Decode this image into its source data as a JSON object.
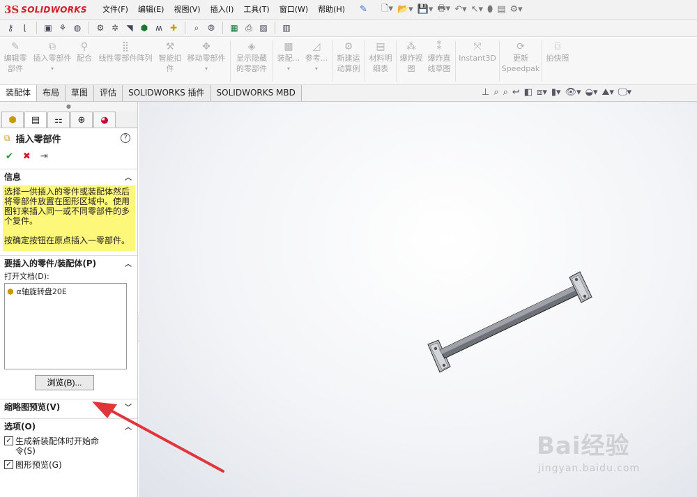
{
  "app": {
    "logo_ds": "3S",
    "logo_name": "SOLIDWORKS"
  },
  "menu": [
    "文件(F)",
    "编辑(E)",
    "视图(V)",
    "插入(I)",
    "工具(T)",
    "窗口(W)",
    "帮助(H)"
  ],
  "commands": [
    {
      "label": "编辑零\n部件",
      "icon": "edit-component-icon"
    },
    {
      "label": "插入零部件",
      "icon": "insert-component-icon"
    },
    {
      "label": "配合",
      "icon": "mate-icon"
    },
    {
      "label": "线性零部件阵列",
      "icon": "linear-pattern-icon"
    },
    {
      "label": "智能扣\n件",
      "icon": "smart-fastener-icon"
    },
    {
      "label": "移动零部件",
      "icon": "move-component-icon"
    },
    {
      "label": "显示隐藏\n的零部件",
      "icon": "show-hidden-icon"
    },
    {
      "label": "装配...",
      "icon": "assembly-feature-icon"
    },
    {
      "label": "参考...",
      "icon": "reference-geometry-icon"
    },
    {
      "label": "新建运\n动算例",
      "icon": "motion-study-icon"
    },
    {
      "label": "材料明\n细表",
      "icon": "bom-icon"
    },
    {
      "label": "爆炸视\n图",
      "icon": "exploded-view-icon"
    },
    {
      "label": "爆炸直\n线草图",
      "icon": "explode-line-icon"
    },
    {
      "label": "Instant3D",
      "icon": "instant3d-icon"
    },
    {
      "label": "更新\nSpeedpak",
      "icon": "speedpak-icon"
    },
    {
      "label": "拍快照",
      "icon": "snapshot-icon"
    }
  ],
  "tabs": [
    "装配体",
    "布局",
    "草图",
    "评估",
    "SOLIDWORKS 插件",
    "SOLIDWORKS MBD"
  ],
  "panel": {
    "title": "插入零部件",
    "help": "?",
    "info_header": "信息",
    "info_text_1": "选择一供插入的零件或装配体然后将零部件放置在图形区域中。使用图钉来插入同一或不同零部件的多个复件。",
    "info_text_2": "按确定按钮在原点插入一零部件。",
    "part_header": "要插入的零件/装配体(P)",
    "open_docs_label": "打开文档(D):",
    "open_docs": [
      "α轴旋转盘20E"
    ],
    "browse_label": "浏览(B)...",
    "thumb_header": "缩略图预览(V)",
    "options_header": "选项(O)",
    "opt_start_cmd": "生成新装配体时开始命令(S)",
    "opt_graphics_preview": "图形预览(G)"
  },
  "watermark": {
    "big": "Bai经验",
    "small": "jingyan.baidu.com"
  },
  "colors": {
    "brand": "#d11f2a",
    "info_bg": "#fdf77a",
    "arrow": "#e0353a"
  }
}
